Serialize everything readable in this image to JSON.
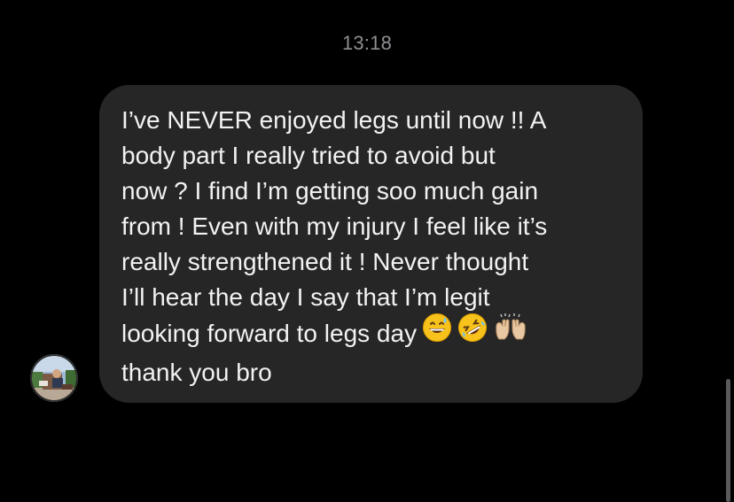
{
  "thread": {
    "timestamp": "13:18"
  },
  "message": {
    "lines": [
      "I’ve NEVER enjoyed legs until now !! A",
      "body part I really tried to avoid but",
      "now ? I find I’m getting soo much gain",
      "from ! Even with my injury I feel like it’s",
      "really strengthened it ! Never thought",
      "I’ll hear the day I say that I’m legit",
      "looking forward to legs day",
      "thank you bro"
    ],
    "emojis": [
      "grinning-face-with-sweat-icon",
      "rolling-on-floor-laughing-icon",
      "raising-hands-icon"
    ]
  },
  "colors": {
    "background": "#000000",
    "bubble": "#262626",
    "message_text": "#f2f2f2",
    "timestamp_text": "#8e8e93"
  },
  "sender": {
    "avatar_icon": "profile-photo-avatar"
  }
}
